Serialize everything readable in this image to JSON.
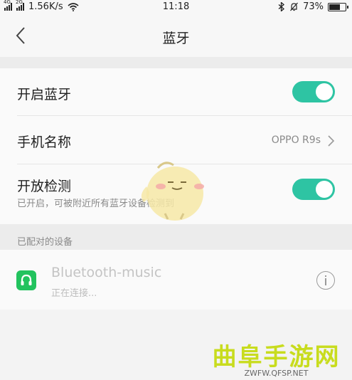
{
  "status_bar": {
    "sim1_tag": "4G",
    "sim2_tag": "2G",
    "net_speed": "1.56K/s",
    "time": "11:18",
    "battery_percent": "73%",
    "battery_level": 0.73
  },
  "header": {
    "title": "蓝牙",
    "back_icon": "chevron-left-icon"
  },
  "settings": {
    "bluetooth": {
      "label": "开启蓝牙",
      "enabled": true
    },
    "device_name": {
      "label": "手机名称",
      "value": "OPPO R9s"
    },
    "visibility": {
      "label": "开放检测",
      "hint": "已开启，可被附近所有蓝牙设备检测到",
      "enabled": true
    }
  },
  "paired": {
    "section_title": "已配对的设备",
    "devices": [
      {
        "name": "Bluetooth-music",
        "status": "正在连接...",
        "icon": "headset-icon"
      }
    ]
  },
  "watermark": {
    "title": "曲阜手游网",
    "url": "ZWFW.QFSP.NET"
  },
  "colors": {
    "accent": "#2ec4a3",
    "device_icon": "#22c35e",
    "watermark": "#c8dc1e"
  }
}
